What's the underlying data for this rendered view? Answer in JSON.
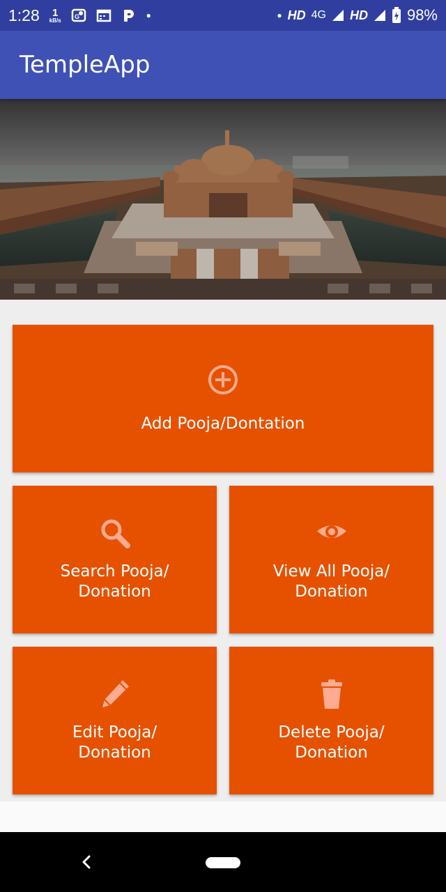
{
  "status_bar": {
    "time": "1:28",
    "speed_value": "1",
    "speed_unit": "kB/s",
    "network_1": "HD",
    "network_type": "4G",
    "network_2": "HD",
    "battery": "98%"
  },
  "app_bar": {
    "title": "TempleApp"
  },
  "banner": {
    "description_icon": "temple-photo"
  },
  "tiles": [
    {
      "label": "Add Pooja/Dontation",
      "icon": "add-circle-icon"
    },
    {
      "label": "Search Pooja/\nDonation",
      "icon": "search-icon"
    },
    {
      "label": "View All Pooja/\nDonation",
      "icon": "eye-icon"
    },
    {
      "label": "Edit Pooja/\nDonation",
      "icon": "pencil-icon"
    },
    {
      "label": "Delete Pooja/\nDonation",
      "icon": "trash-icon"
    }
  ],
  "colors": {
    "status_bar": "#303f9f",
    "app_bar": "#3f51b5",
    "tile": "#e65100",
    "tile_icon": "#ffab91"
  }
}
